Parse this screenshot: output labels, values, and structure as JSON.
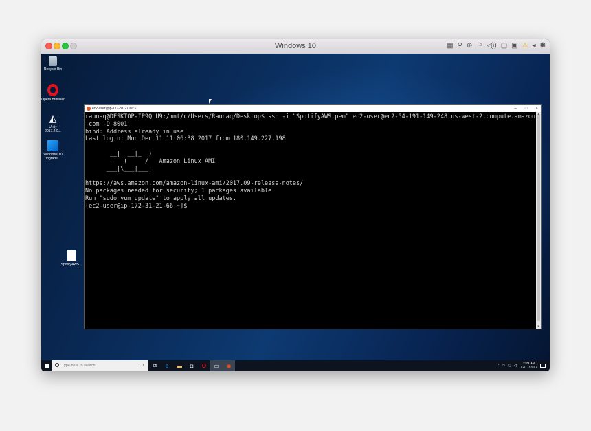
{
  "vm": {
    "title": "Windows 10",
    "status_icons": [
      "keyboard-icon",
      "mic-icon",
      "camera-icon",
      "network-icon",
      "sound-icon",
      "usb-icon",
      "display-icon",
      "warning-icon",
      "back-arrow-icon",
      "gear-icon"
    ],
    "status_glyphs": [
      "▦",
      "⚲",
      "⊕",
      "⚐",
      "◁))",
      "▢",
      "▣",
      "⚠",
      "◂",
      "✱"
    ]
  },
  "desktop": {
    "icons": [
      {
        "label": "Recycle Bin",
        "icon": "recycle-bin-icon"
      },
      {
        "label": "Opera Browser",
        "icon": "opera-icon"
      },
      {
        "label": "Unity 2017.2.0...",
        "icon": "unity-icon"
      },
      {
        "label": "Windows 10 Upgrade ...",
        "icon": "windows-upgrade-icon"
      },
      {
        "label": "SpotifyAWS...",
        "icon": "file-icon"
      }
    ]
  },
  "terminal": {
    "title": "ec2-user@ip-172-31-21-66:~",
    "controls": [
      "–",
      "□",
      "×"
    ],
    "lines": [
      "raunaq@DESKTOP-IP9QLU9:/mnt/c/Users/Raunaq/Desktop$ ssh -i \"SpotifyAWS.pem\" ec2-user@ec2-54-191-149-248.us-west-2.compute.amazonaws",
      ".com -D 8001",
      "bind: Address already in use",
      "Last login: Mon Dec 11 11:06:38 2017 from 180.149.227.198",
      "",
      "       __|  __|_  )",
      "       _|  (     /   Amazon Linux AMI",
      "      ___|\\___|___|",
      "",
      "https://aws.amazon.com/amazon-linux-ami/2017.09-release-notes/",
      "No packages needed for security; 1 packages available",
      "Run \"sudo yum update\" to apply all updates.",
      "[ec2-user@ip-172-31-21-66 ~]$"
    ]
  },
  "taskbar": {
    "search_placeholder": "Type here to search",
    "apps": [
      {
        "name": "task-view-icon",
        "glyph": "⧉"
      },
      {
        "name": "edge-icon",
        "glyph": "e"
      },
      {
        "name": "file-explorer-icon",
        "glyph": "▬"
      },
      {
        "name": "store-icon",
        "glyph": "◘"
      },
      {
        "name": "opera-taskbar-icon",
        "glyph": "O"
      },
      {
        "name": "terminal-taskbar-icon",
        "glyph": "▭"
      },
      {
        "name": "ubuntu-taskbar-icon",
        "glyph": "◉"
      }
    ],
    "tray": {
      "time": "3:09 AM",
      "date": "12/11/2017"
    }
  },
  "colors": {
    "desktop_bg": "#0a2d5c",
    "terminal_bg": "#000000",
    "terminal_fg": "#d4d4d4",
    "taskbar_bg": "#0d1420"
  }
}
